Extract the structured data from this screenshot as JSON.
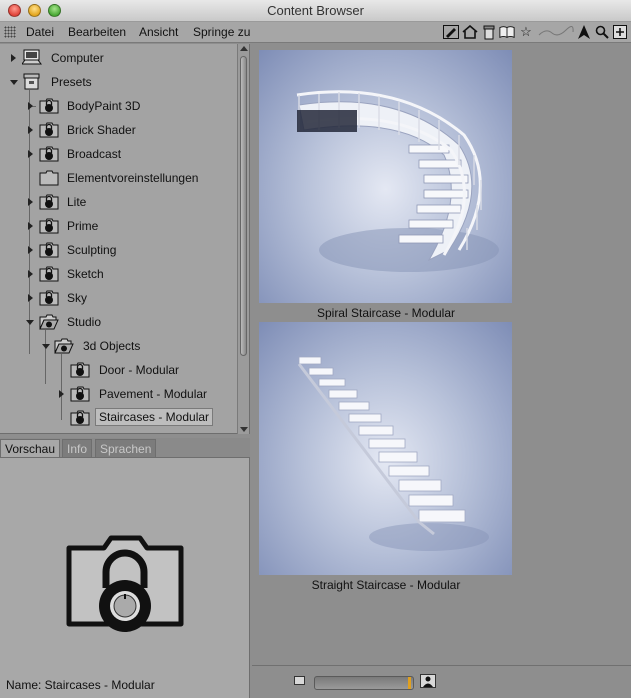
{
  "window": {
    "title": "Content Browser"
  },
  "menubar": {
    "items": [
      "Datei",
      "Bearbeiten",
      "Ansicht",
      "Springe zu"
    ],
    "tools": [
      "pencil-icon",
      "home-icon",
      "trash-icon",
      "book-icon",
      "star-icon",
      "cursor-icon",
      "search-icon",
      "add-icon"
    ]
  },
  "tree": {
    "items": [
      {
        "label": "Computer",
        "icon": "computer-icon",
        "expand": "right"
      },
      {
        "label": "Presets",
        "icon": "archive-icon",
        "expand": "down"
      },
      {
        "label": "BodyPaint 3D",
        "icon": "locked-folder-icon",
        "expand": "right"
      },
      {
        "label": "Brick Shader",
        "icon": "locked-folder-icon",
        "expand": "right"
      },
      {
        "label": "Broadcast",
        "icon": "locked-folder-icon",
        "expand": "right"
      },
      {
        "label": "Elementvoreinstellungen",
        "icon": "folder-icon",
        "expand": "none"
      },
      {
        "label": "Lite",
        "icon": "locked-folder-icon",
        "expand": "right"
      },
      {
        "label": "Prime",
        "icon": "locked-folder-icon",
        "expand": "right"
      },
      {
        "label": "Sculpting",
        "icon": "locked-folder-icon",
        "expand": "right"
      },
      {
        "label": "Sketch",
        "icon": "locked-folder-icon",
        "expand": "right"
      },
      {
        "label": "Sky",
        "icon": "locked-folder-icon",
        "expand": "right"
      },
      {
        "label": "Studio",
        "icon": "open-locked-folder-icon",
        "expand": "down"
      },
      {
        "label": "3d Objects",
        "icon": "open-locked-folder-icon",
        "expand": "down"
      },
      {
        "label": "Door - Modular",
        "icon": "locked-folder-icon",
        "expand": "none"
      },
      {
        "label": "Pavement - Modular",
        "icon": "locked-folder-icon",
        "expand": "right"
      },
      {
        "label": "Staircases - Modular",
        "icon": "locked-folder-icon",
        "expand": "none",
        "selected": true
      }
    ]
  },
  "tabs": {
    "items": [
      "Vorschau",
      "Info",
      "Sprachen"
    ],
    "active": "Vorschau"
  },
  "preview": {
    "name": "Name:  Staircases - Modular"
  },
  "content": {
    "tiles": [
      {
        "caption": "Spiral Staircase - Modular"
      },
      {
        "caption": "Straight Staircase - Modular"
      }
    ]
  },
  "zoom": {
    "level": 0.98
  }
}
